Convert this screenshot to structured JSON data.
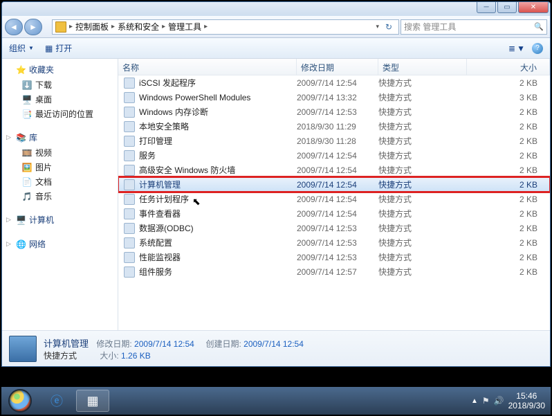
{
  "breadcrumb": [
    "控制面板",
    "系统和安全",
    "管理工具"
  ],
  "search_placeholder": "搜索 管理工具",
  "toolbar": {
    "organize": "组织",
    "open": "打开"
  },
  "nav_tree": {
    "favorites": {
      "label": "收藏夹",
      "items": [
        {
          "icon": "⬇️",
          "label": "下载"
        },
        {
          "icon": "🖥️",
          "label": "桌面"
        },
        {
          "icon": "📑",
          "label": "最近访问的位置"
        }
      ]
    },
    "libraries": {
      "label": "库",
      "items": [
        {
          "icon": "🎞️",
          "label": "视频"
        },
        {
          "icon": "🖼️",
          "label": "图片"
        },
        {
          "icon": "📄",
          "label": "文档"
        },
        {
          "icon": "🎵",
          "label": "音乐"
        }
      ]
    },
    "computer": {
      "label": "计算机"
    },
    "network": {
      "label": "网络"
    }
  },
  "columns": {
    "name": "名称",
    "date": "修改日期",
    "type": "类型",
    "size": "大小"
  },
  "file_type": "快捷方式",
  "files": [
    {
      "name": "iSCSI 发起程序",
      "date": "2009/7/14 12:54",
      "size": "2 KB"
    },
    {
      "name": "Windows PowerShell Modules",
      "date": "2009/7/14 13:32",
      "size": "3 KB"
    },
    {
      "name": "Windows 内存诊断",
      "date": "2009/7/14 12:53",
      "size": "2 KB"
    },
    {
      "name": "本地安全策略",
      "date": "2018/9/30 11:29",
      "size": "2 KB"
    },
    {
      "name": "打印管理",
      "date": "2018/9/30 11:28",
      "size": "2 KB"
    },
    {
      "name": "服务",
      "date": "2009/7/14 12:54",
      "size": "2 KB"
    },
    {
      "name": "高级安全 Windows 防火墙",
      "date": "2009/7/14 12:54",
      "size": "2 KB"
    },
    {
      "name": "计算机管理",
      "date": "2009/7/14 12:54",
      "size": "2 KB"
    },
    {
      "name": "任务计划程序",
      "date": "2009/7/14 12:54",
      "size": "2 KB"
    },
    {
      "name": "事件查看器",
      "date": "2009/7/14 12:54",
      "size": "2 KB"
    },
    {
      "name": "数据源(ODBC)",
      "date": "2009/7/14 12:53",
      "size": "2 KB"
    },
    {
      "name": "系统配置",
      "date": "2009/7/14 12:53",
      "size": "2 KB"
    },
    {
      "name": "性能监视器",
      "date": "2009/7/14 12:53",
      "size": "2 KB"
    },
    {
      "name": "组件服务",
      "date": "2009/7/14 12:57",
      "size": "2 KB"
    }
  ],
  "selected_index": 7,
  "details": {
    "title": "计算机管理",
    "type": "快捷方式",
    "mod_label": "修改日期:",
    "mod_val": "2009/7/14 12:54",
    "created_label": "创建日期:",
    "created_val": "2009/7/14 12:54",
    "size_label": "大小:",
    "size_val": "1.26 KB"
  },
  "clock": {
    "time": "15:46",
    "date": "2018/9/30"
  }
}
